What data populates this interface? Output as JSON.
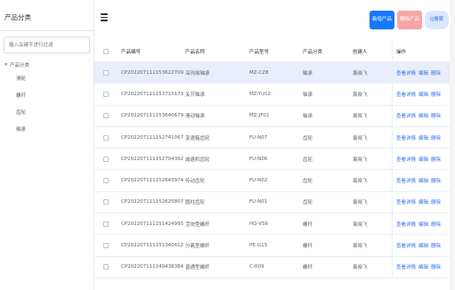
{
  "sidebar": {
    "title": "产品分类",
    "filter_placeholder": "输入关键字进行过滤",
    "tree_root": "产品分类",
    "tree_children": [
      "滑轮",
      "螺杆",
      "齿轮",
      "轴承"
    ]
  },
  "toolbar": {
    "add_label": "新增产品",
    "delete_label": "删除产品",
    "search_label": "Q搜索"
  },
  "table": {
    "headers": [
      "产品编号",
      "产品名称",
      "产品型号",
      "产品分类",
      "创建人",
      "操作"
    ],
    "row_actions": [
      "查看详情",
      "编辑",
      "删除"
    ],
    "rows": [
      {
        "code": "CP202207111153622709",
        "name": "深沟球轴承",
        "model": "MZ-CZ8",
        "category": "轴承",
        "creator": "袁晓飞"
      },
      {
        "code": "CP202207111153715173",
        "name": "关节轴承",
        "model": "MZ-YU12",
        "category": "轴承",
        "creator": "袁晓飞"
      },
      {
        "code": "CP202207111153640679",
        "name": "滑动轴承",
        "model": "MZ-JF01",
        "category": "轴承",
        "creator": "袁晓飞"
      },
      {
        "code": "CP202207111152741067",
        "name": "变速箱齿轮",
        "model": "FU-N07",
        "category": "齿轮",
        "creator": "袁晓飞"
      },
      {
        "code": "CP202207111152704392",
        "name": "减速机齿轮",
        "model": "FU-N06",
        "category": "齿轮",
        "creator": "袁晓飞"
      },
      {
        "code": "CP202207111152643974",
        "name": "传动齿轮",
        "model": "FU-N02",
        "category": "齿轮",
        "creator": "袁晓飞"
      },
      {
        "code": "CP202207111152625807",
        "name": "圆柱齿轮",
        "model": "FU-N01",
        "category": "齿轮",
        "creator": "袁晓飞"
      },
      {
        "code": "CP202207111151424995",
        "name": "活块型螺杆",
        "model": "HQ-VS6",
        "category": "螺杆",
        "creator": "袁晓飞"
      },
      {
        "code": "CP202207111151340612",
        "name": "分离型螺杆",
        "model": "PE-G15",
        "category": "螺杆",
        "creator": "袁晓飞"
      },
      {
        "code": "CP202207111149438384",
        "name": "普通型螺杆",
        "model": "C-R09",
        "category": "螺杆",
        "creator": "袁晓飞"
      }
    ],
    "selected_row": 0
  }
}
